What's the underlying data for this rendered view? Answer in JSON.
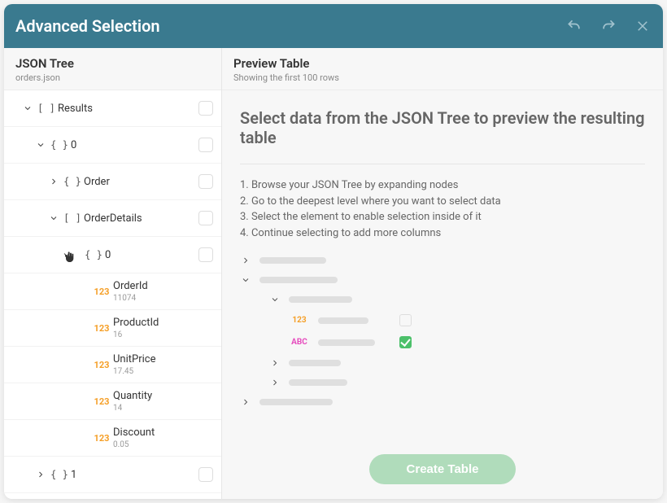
{
  "header": {
    "title": "Advanced Selection"
  },
  "left": {
    "title": "JSON Tree",
    "filename": "orders.json"
  },
  "tree": {
    "root": {
      "label": "Results",
      "type": "[ ]"
    },
    "n0": {
      "label": "0",
      "type": "{ }"
    },
    "order": {
      "label": "Order",
      "type": "{ }"
    },
    "orderDetails": {
      "label": "OrderDetails",
      "type": "[ ]"
    },
    "d0": {
      "label": "0",
      "type": "{ }"
    },
    "leaf_orderId": {
      "badge": "123",
      "name": "OrderId",
      "value": "11074"
    },
    "leaf_productId": {
      "badge": "123",
      "name": "ProductId",
      "value": "16"
    },
    "leaf_unitPrice": {
      "badge": "123",
      "name": "UnitPrice",
      "value": "17.45"
    },
    "leaf_quantity": {
      "badge": "123",
      "name": "Quantity",
      "value": "14"
    },
    "leaf_discount": {
      "badge": "123",
      "name": "Discount",
      "value": "0.05"
    },
    "n1": {
      "label": "1",
      "type": "{ }"
    }
  },
  "right": {
    "title": "Preview Table",
    "subtitle": "Showing the first 100 rows",
    "previewTitle": "Select data from the JSON Tree to preview the resulting table",
    "instructions": [
      "1. Browse your JSON Tree by expanding nodes",
      "2. Go to the deepest level where you want to select data",
      "3. Select the element to enable selection inside of it",
      "4. Continue selecting to add more columns"
    ],
    "createLabel": "Create Table"
  },
  "skeleton": {
    "badge_num": "123",
    "badge_abc": "ABC"
  }
}
